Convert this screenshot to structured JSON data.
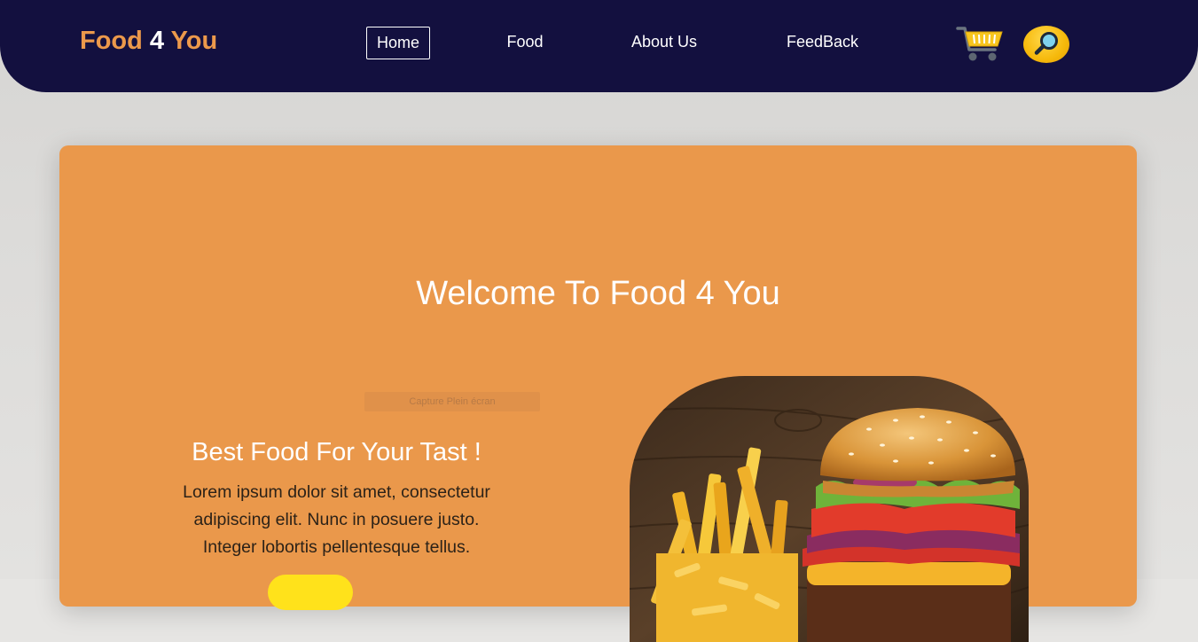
{
  "header": {
    "logo": {
      "part1": "Food",
      "part2": "4",
      "part3": "You"
    },
    "nav": [
      {
        "label": "Home",
        "active": true
      },
      {
        "label": "Food",
        "active": false
      },
      {
        "label": "About Us",
        "active": false
      },
      {
        "label": "FeedBack",
        "active": false
      }
    ],
    "icons": {
      "cart": "cart-icon",
      "search": "search-icon"
    }
  },
  "hero": {
    "title": "Welcome To Food 4 You",
    "overlay_label": "Capture Plein écran",
    "subtitle": "Best Food For Your Tast !",
    "description_lines": [
      "Lorem ipsum dolor sit amet, consectetur",
      "adipiscing elit. Nunc in posuere justo.",
      "Integer lobortis pellentesque tellus."
    ],
    "image": "burger-and-fries-image"
  },
  "colors": {
    "navbar": "#13103f",
    "accent": "#ec994b",
    "hero_background": "#ea984b",
    "button": "#ffe21b",
    "text_light": "#ffffff"
  }
}
